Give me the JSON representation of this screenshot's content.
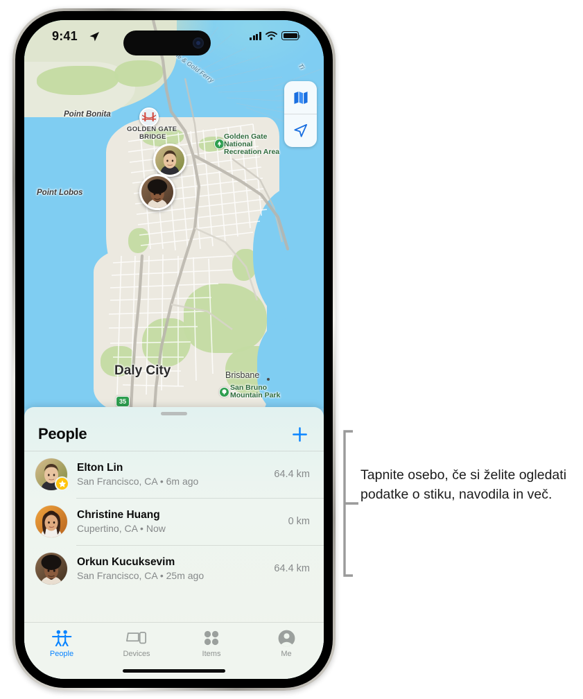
{
  "statusbar": {
    "time": "9:41",
    "location_arrow_icon": "location-arrow-icon",
    "cellular_icon": "cellular-bars-icon",
    "wifi_icon": "wifi-icon",
    "battery_icon": "battery-icon"
  },
  "map": {
    "controls": [
      {
        "name": "map-style-button",
        "icon": "map-icon"
      },
      {
        "name": "recenter-button",
        "icon": "location-arrow-icon"
      }
    ],
    "labels": [
      {
        "text": "Point Bonita",
        "style": "italic"
      },
      {
        "text": "Point Lobos",
        "style": "italic"
      },
      {
        "text": "GOLDEN GATE",
        "style": "caps"
      },
      {
        "text": "BRIDGE",
        "style": "caps"
      },
      {
        "text": "Golden Gate",
        "style": "park"
      },
      {
        "text": "National",
        "style": "park"
      },
      {
        "text": "Recreation Area",
        "style": "park"
      },
      {
        "text": "Daly City",
        "style": "city"
      },
      {
        "text": "Brisbane",
        "style": "city-small"
      },
      {
        "text": "San Bruno",
        "style": "park"
      },
      {
        "text": "Mountain Park",
        "style": "park"
      },
      {
        "text": "le & Gold Ferry",
        "style": "ferry"
      },
      {
        "text": "Ti",
        "style": "ferry"
      },
      {
        "text": "35",
        "style": "shield"
      }
    ],
    "pins": [
      {
        "name": "map-pin-elton-lin"
      },
      {
        "name": "map-pin-orkun-kucuksevim"
      },
      {
        "name": "map-pin-golden-gate-bridge"
      },
      {
        "name": "map-pin-golden-gate-national-recreation-area"
      },
      {
        "name": "map-pin-san-bruno-mountain-park"
      }
    ]
  },
  "sheet": {
    "title": "People",
    "add_button_label": "+",
    "people": [
      {
        "name": "Elton Lin",
        "subtitle": "San Francisco, CA • 6m ago",
        "distance": "64.4 km",
        "has_star": true
      },
      {
        "name": "Christine Huang",
        "subtitle": "Cupertino, CA • Now",
        "distance": "0 km",
        "has_star": false
      },
      {
        "name": "Orkun Kucuksevim",
        "subtitle": "San Francisco, CA • 25m ago",
        "distance": "64.4 km",
        "has_star": false
      }
    ]
  },
  "tabbar": {
    "tabs": [
      {
        "label": "People",
        "icon": "people-icon",
        "active": true
      },
      {
        "label": "Devices",
        "icon": "devices-icon",
        "active": false
      },
      {
        "label": "Items",
        "icon": "items-grid-icon",
        "active": false
      },
      {
        "label": "Me",
        "icon": "person-circle-icon",
        "active": false
      }
    ]
  },
  "callout": {
    "text": "Tapnite osebo, če si želite ogledati podatke o stiku, navodila in več."
  },
  "colors": {
    "accent": "#0a84ff",
    "star": "#ffc40c",
    "water": "#7fcdf2",
    "land": "#ece9e0",
    "park": "#c4dba2",
    "secondary_text": "#86898a"
  }
}
